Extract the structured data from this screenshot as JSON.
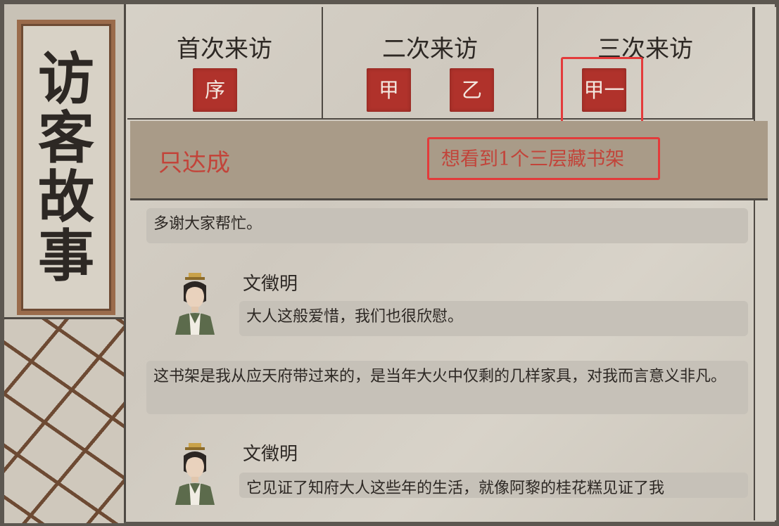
{
  "left_panel": {
    "title_chars": [
      "访",
      "客",
      "故",
      "事"
    ]
  },
  "tabs": [
    {
      "title": "首次来访",
      "stamps": [
        "序"
      ]
    },
    {
      "title": "二次来访",
      "stamps": [
        "甲",
        "乙"
      ]
    },
    {
      "title": "三次来访",
      "stamps": [
        "甲一"
      ]
    }
  ],
  "condition": {
    "label": "只达成",
    "requirement": "想看到1个三层藏书架"
  },
  "dialog": {
    "line1": "多谢大家帮忙。",
    "speaker1": "文徵明",
    "reply1": "大人这般爱惜，我们也很欣慰。",
    "line2": "这书架是我从应天府带过来的，是当年大火中仅剩的几样家具，对我而言意义非凡。",
    "speaker2": "文徵明",
    "reply2": "它见证了知府大人这些年的生活，就像阿黎的桂花糕见证了我"
  },
  "colors": {
    "stamp_red": "#b0322b",
    "highlight_red": "#e33b3b",
    "condition_text": "#c2443a"
  }
}
